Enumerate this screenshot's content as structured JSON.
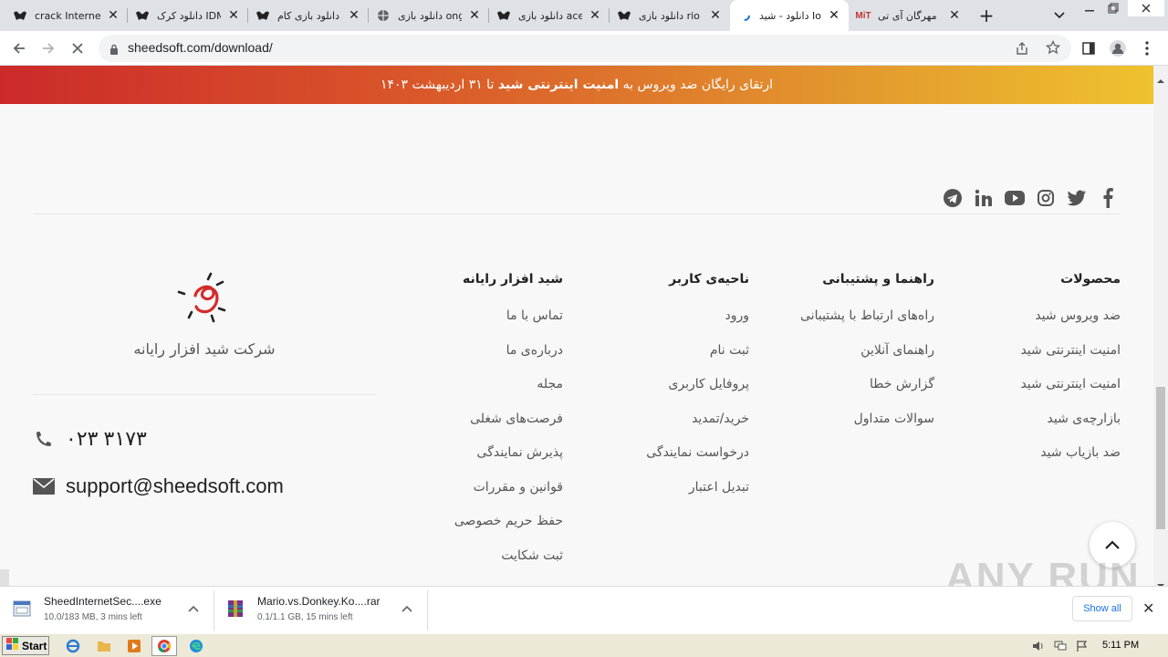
{
  "tabs": [
    {
      "title": "crack Internet"
    },
    {
      "title": "دانلود کرک IDM"
    },
    {
      "title": "دانلود بازی کام"
    },
    {
      "title": "دانلود بازی ong"
    },
    {
      "title": "دانلود بازی ace"
    },
    {
      "title": "دانلود بازی rio"
    },
    {
      "title": "دانلود - شید Io"
    },
    {
      "title": "مهرگان آی تی"
    }
  ],
  "address": {
    "url": "sheedsoft.com/download/"
  },
  "banner": {
    "prefix": "ارتقای رایگان ضد ویروس به",
    "bold": "امنیت اینترنتی شید",
    "suffix": "تا ۳۱ اردیبهشت ۱۴۰۳"
  },
  "social": [
    "facebook-icon",
    "twitter-icon",
    "instagram-icon",
    "youtube-icon",
    "linkedin-icon",
    "telegram-icon"
  ],
  "columns": {
    "products": {
      "title": "محصولات",
      "items": [
        "ضد ویروس شید",
        "امنیت اینترنتی شید",
        "امنیت اینترنتی شید",
        "بازارچه‌ی شید",
        "ضد بازیاب شید"
      ]
    },
    "support": {
      "title": "راهنما و پشتیبانی",
      "items": [
        "راه‌های ارتباط با پشتیبانی",
        "راهنمای آنلاین",
        "گزارش خطا",
        "سوالات متداول"
      ]
    },
    "user": {
      "title": "ناحیه‌ی کاربر",
      "items": [
        "ورود",
        "ثبت نام",
        "پروفایل کاربری",
        "خرید/تمدید",
        "درخواست نمایندگی",
        "تبدیل اعتبار"
      ]
    },
    "company": {
      "title": "شید افزار رایانه",
      "items": [
        "تماس با ما",
        "درباره‌ی ما",
        "مجله",
        "فرصت‌های شغلی",
        "پذیرش نمایندگی",
        "قوانین و مقررات",
        "حفظ حریم خصوصی",
        "ثبت شکایت"
      ]
    }
  },
  "brand": {
    "name": "شرکت شید افزار رایانه"
  },
  "contact": {
    "phone": "۰۲۳ ۳۱۷۳",
    "email": "support@sheedsoft.com"
  },
  "downloads": [
    {
      "name": "SheedInternetSec....exe",
      "status": "10.0/183 MB, 3 mins left"
    },
    {
      "name": "Mario.vs.Donkey.Ko....rar",
      "status": "0.1/1.1 GB, 15 mins left"
    }
  ],
  "download_bar": {
    "show_all": "Show all"
  },
  "watermark": "ANY RUN",
  "taskbar": {
    "start": "Start",
    "clock": "5:11 PM"
  },
  "colors": {
    "banner_start": "#cc2a2a",
    "banner_end": "#efc22f",
    "link_blue": "#1a73e8"
  }
}
